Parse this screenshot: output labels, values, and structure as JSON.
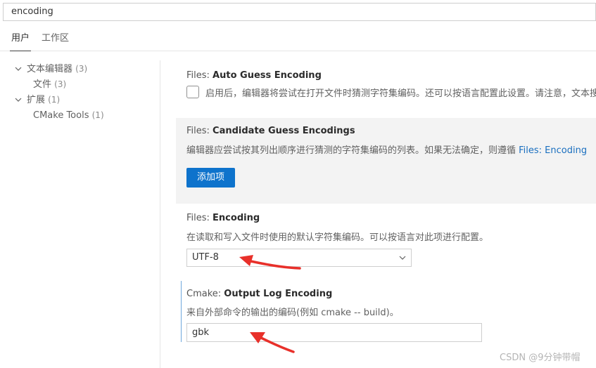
{
  "search": {
    "value": "encoding"
  },
  "tabs": [
    {
      "label": "用户",
      "active": true
    },
    {
      "label": "工作区",
      "active": false
    }
  ],
  "toc": {
    "items": [
      {
        "label": "文本编辑器",
        "count": "(3)",
        "expanded": true
      },
      {
        "label": "文件",
        "count": "(3)"
      },
      {
        "label": "扩展",
        "count": "(1)",
        "expanded": true
      },
      {
        "label": "CMake Tools",
        "count": "(1)"
      }
    ]
  },
  "settings": {
    "auto_guess": {
      "category": "Files: ",
      "name": "Auto Guess Encoding",
      "description": "启用后，编辑器将尝试在打开文件时猜测字符集编码。还可以按语言配置此设置。请注意，文本搜",
      "checked": false
    },
    "candidate": {
      "category": "Files: ",
      "name": "Candidate Guess Encodings",
      "description": "编辑器应尝试按其列出顺序进行猜测的字符集编码的列表。如果无法确定，则遵循 ",
      "link": "Files: Encoding",
      "button": "添加项"
    },
    "encoding": {
      "category": "Files: ",
      "name": "Encoding",
      "description": "在读取和写入文件时使用的默认字符集编码。可以按语言对此项进行配置。",
      "value": "UTF-8"
    },
    "cmake_log": {
      "category": "Cmake: ",
      "name": "Output Log Encoding",
      "description": "来自外部命令的输出的编码(例如 cmake -- build)。",
      "value": "gbk"
    }
  },
  "annotation_color": "#e8302a",
  "accent_color": "#0e73cc",
  "watermark": "CSDN @9分钟带帽"
}
